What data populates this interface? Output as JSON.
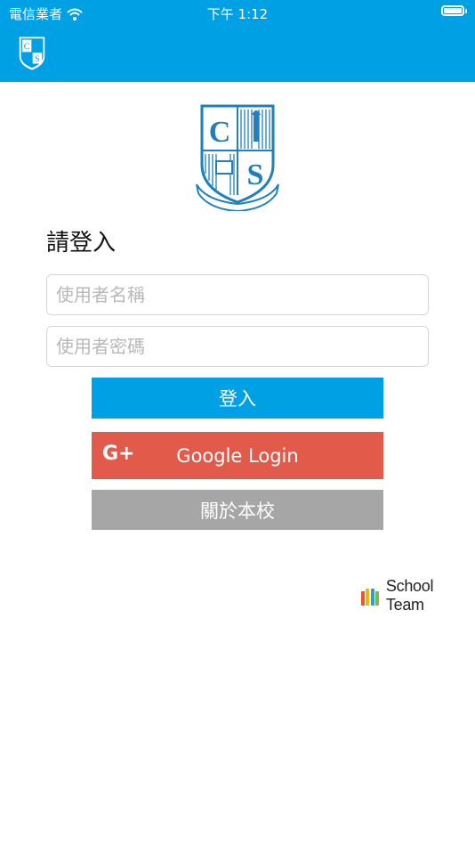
{
  "status_bar": {
    "carrier": "電信業者",
    "time": "下午 1:12",
    "battery_level": 1.0
  },
  "header": {
    "logo": "school-crest-icon"
  },
  "login": {
    "heading": "請登入",
    "username_placeholder": "使用者名稱",
    "password_placeholder": "使用者密碼",
    "login_button": "登入",
    "google_button": "Google Login",
    "google_icon": "G+",
    "about_button": "關於本校"
  },
  "brand": {
    "name": "School Team"
  },
  "colors": {
    "primary": "#00a0e4",
    "google": "#e15a4a",
    "about": "#a6a6a6",
    "crest": "#1f7fbf"
  }
}
